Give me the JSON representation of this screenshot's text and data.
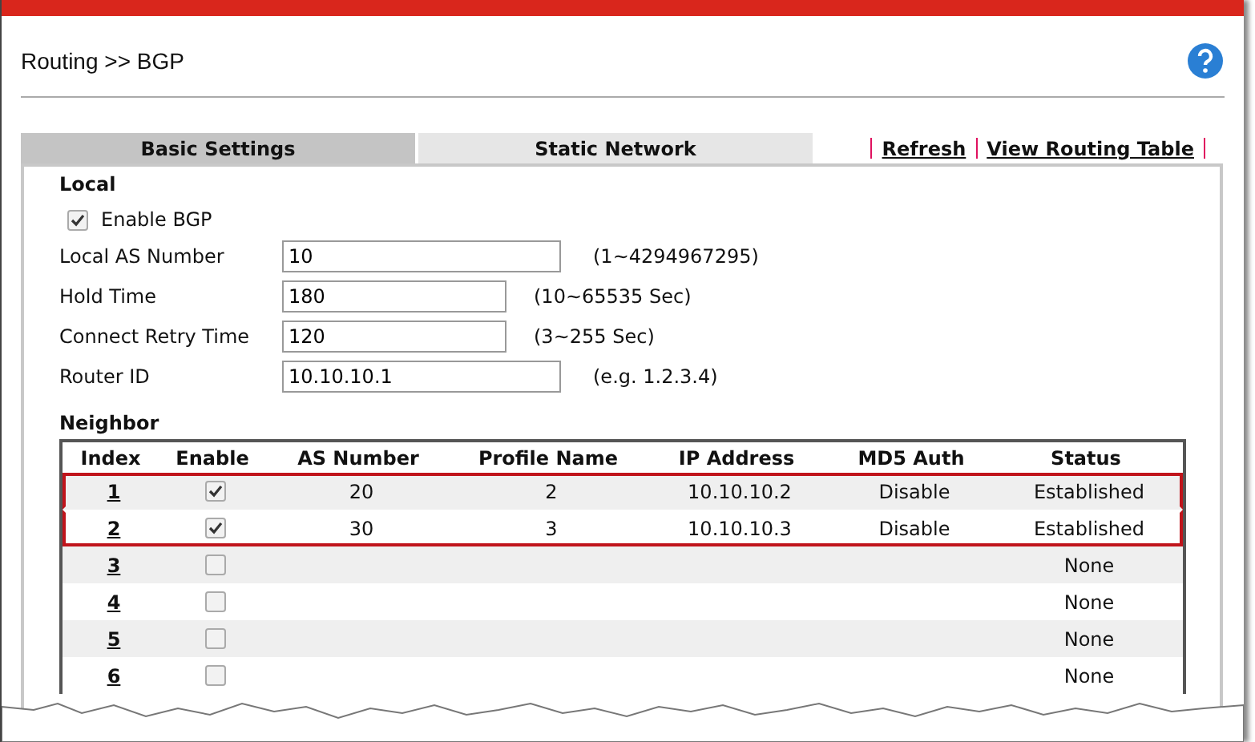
{
  "breadcrumb": "Routing >> BGP",
  "tabs": [
    {
      "label": "Basic Settings",
      "selected": true
    },
    {
      "label": "Static Network",
      "selected": false
    }
  ],
  "links": [
    "Refresh",
    "View Routing Table"
  ],
  "local": {
    "heading": "Local",
    "enable": {
      "label": "Enable BGP",
      "checked": true
    },
    "fields": [
      {
        "label": "Local AS Number",
        "value": "10",
        "hint": "(1~4294967295)",
        "kind": "wide"
      },
      {
        "label": "Hold Time",
        "value": "180",
        "hint": "(10~65535 Sec)",
        "kind": "narrow"
      },
      {
        "label": "Connect Retry Time",
        "value": "120",
        "hint": "(3~255 Sec)",
        "kind": "narrow"
      },
      {
        "label": "Router ID",
        "value": "10.10.10.1",
        "hint": "(e.g. 1.2.3.4)",
        "kind": "wide"
      }
    ]
  },
  "neighbor": {
    "heading": "Neighbor",
    "columns": [
      "Index",
      "Enable",
      "AS Number",
      "Profile Name",
      "IP Address",
      "MD5 Auth",
      "Status"
    ],
    "rows": [
      {
        "index": "1",
        "enabled": true,
        "as_number": "20",
        "profile_name": "2",
        "ip_address": "10.10.10.2",
        "md5_auth": "Disable",
        "status": "Established",
        "highlighted": true
      },
      {
        "index": "2",
        "enabled": true,
        "as_number": "30",
        "profile_name": "3",
        "ip_address": "10.10.10.3",
        "md5_auth": "Disable",
        "status": "Established",
        "highlighted": true
      },
      {
        "index": "3",
        "enabled": false,
        "status": "None",
        "highlighted": false
      },
      {
        "index": "4",
        "enabled": false,
        "status": "None",
        "highlighted": false
      },
      {
        "index": "5",
        "enabled": false,
        "status": "None",
        "highlighted": false
      },
      {
        "index": "6",
        "enabled": false,
        "status": "None",
        "highlighted": false
      }
    ]
  }
}
